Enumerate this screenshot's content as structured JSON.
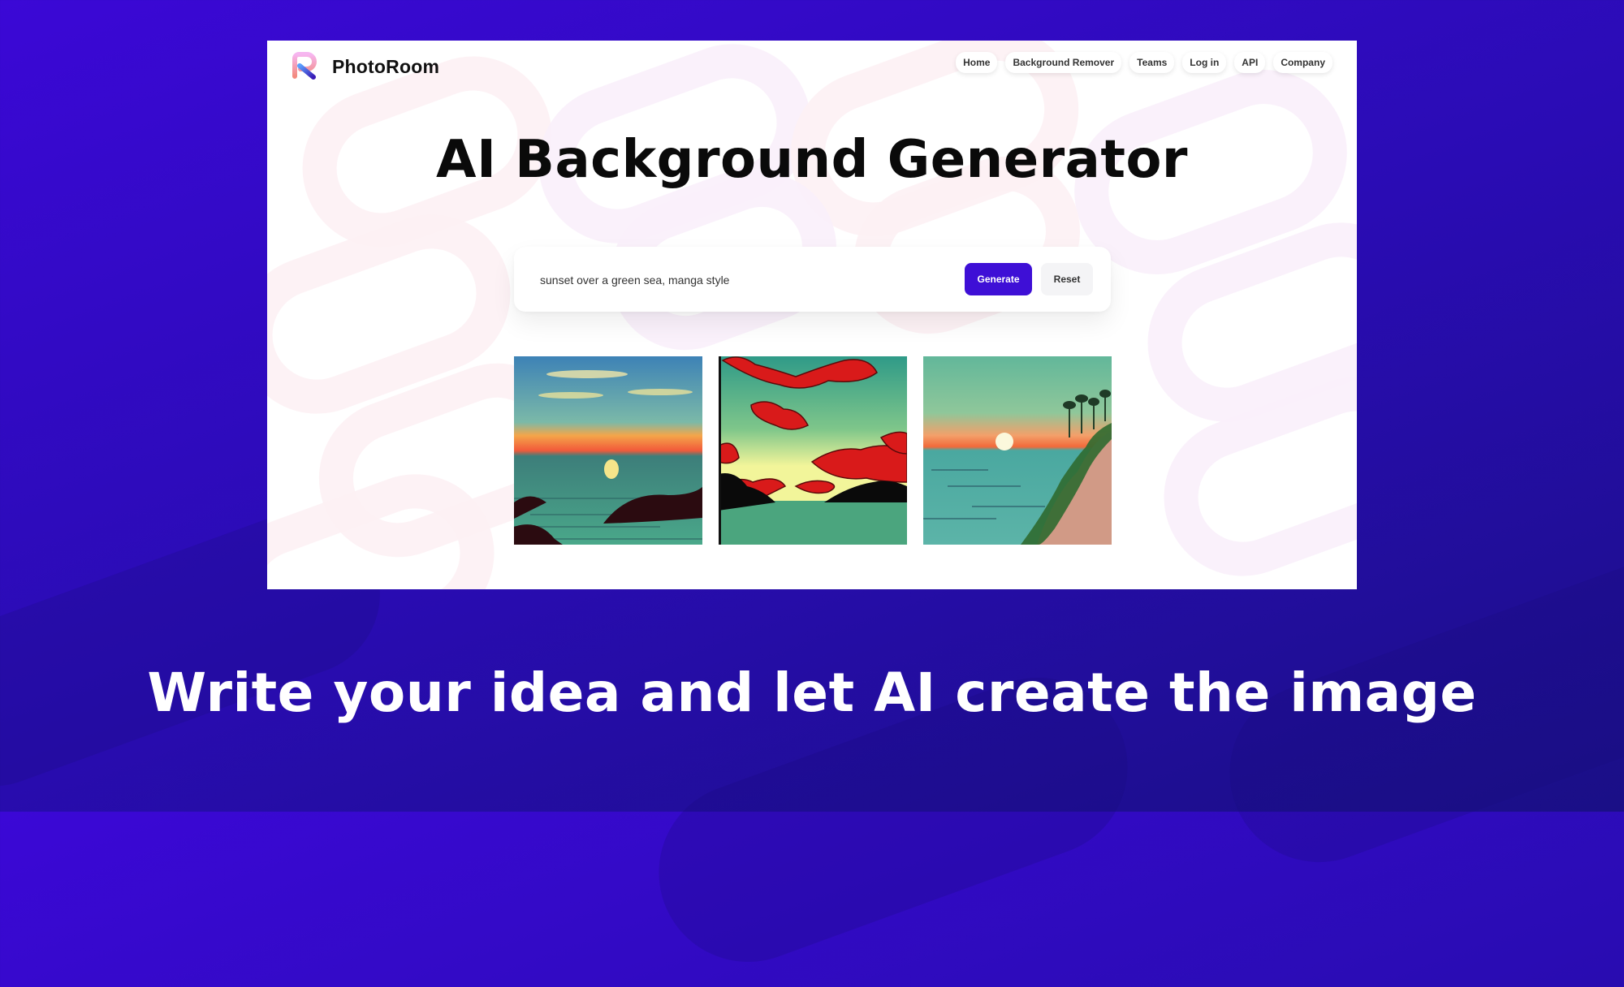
{
  "brand": {
    "name": "PhotoRoom",
    "logo_icon": "photoroom-r-logo-icon"
  },
  "nav": {
    "items": [
      {
        "label": "Home"
      },
      {
        "label": "Background Remover"
      },
      {
        "label": "Teams"
      },
      {
        "label": "Log in"
      },
      {
        "label": "API"
      },
      {
        "label": "Company"
      }
    ]
  },
  "hero": {
    "title": "AI Background Generator"
  },
  "prompt": {
    "value": "sunset over a green sea, manga style",
    "generate_label": "Generate",
    "reset_label": "Reset"
  },
  "gallery": {
    "images": [
      {
        "alt": "Sunset over green sea with dark islands"
      },
      {
        "alt": "Green sky with red clouds over a green sea"
      },
      {
        "alt": "Sunset over a bay with a sandy, forested coastline"
      }
    ]
  },
  "tagline": "Write your idea and let AI create the image",
  "colors": {
    "background": "#3b08d6",
    "accent": "#3e0fd6",
    "screen": "#ffffff"
  }
}
